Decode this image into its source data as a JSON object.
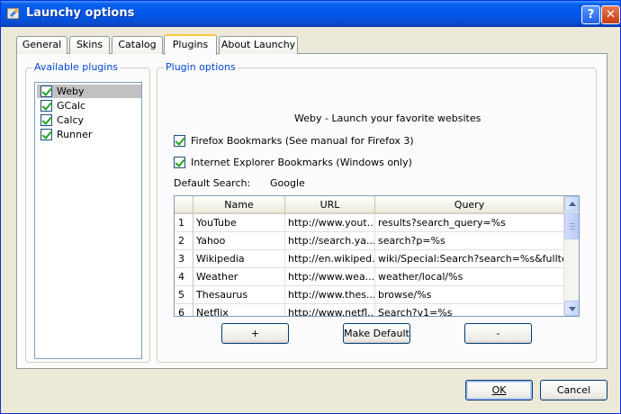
{
  "window": {
    "title": "Launchy options",
    "help_label": "?",
    "close_label": "✕"
  },
  "tabs": [
    {
      "label": "General"
    },
    {
      "label": "Skins"
    },
    {
      "label": "Catalog"
    },
    {
      "label": "Plugins"
    },
    {
      "label": "About Launchy"
    }
  ],
  "active_tab": "Plugins",
  "available_plugins": {
    "label": "Available plugins",
    "items": [
      {
        "label": "Weby",
        "checked": true,
        "selected": true
      },
      {
        "label": "GCalc",
        "checked": true
      },
      {
        "label": "Calcy",
        "checked": true
      },
      {
        "label": "Runner",
        "checked": true
      }
    ]
  },
  "plugin_options": {
    "label": "Plugin options",
    "description": "Weby - Launch your favorite websites",
    "firefox_bookmarks": "Firefox Bookmarks (See manual for Firefox 3)",
    "ie_bookmarks": "Internet Explorer Bookmarks (Windows only)",
    "default_search_label": "Default Search:",
    "default_search_value": "Google",
    "table": {
      "headers": [
        "Name",
        "URL",
        "Query"
      ],
      "rows": [
        {
          "num": "1",
          "name": "YouTube",
          "url": "http://www.yout...",
          "query": "results?search_query=%s"
        },
        {
          "num": "2",
          "name": "Yahoo",
          "url": "http://search.ya...",
          "query": "search?p=%s"
        },
        {
          "num": "3",
          "name": "Wikipedia",
          "url": "http://en.wikiped...",
          "query": "wiki/Special:Search?search=%s&fulltext..."
        },
        {
          "num": "4",
          "name": "Weather",
          "url": "http://www.wea...",
          "query": "weather/local/%s"
        },
        {
          "num": "5",
          "name": "Thesaurus",
          "url": "http://www.thes...",
          "query": "browse/%s"
        },
        {
          "num": "6",
          "name": "Netflix",
          "url": "http://www.netfl...",
          "query": "Search?v1=%s"
        }
      ]
    },
    "add_label": "+",
    "make_default_label": "Make Default",
    "remove_label": "-"
  },
  "footer": {
    "ok_label": "OK",
    "cancel_label": "Cancel"
  },
  "colors": {
    "titlebar": "#0058ee",
    "group_label": "#0046d5",
    "tab_highlight": "#ffc83c"
  }
}
